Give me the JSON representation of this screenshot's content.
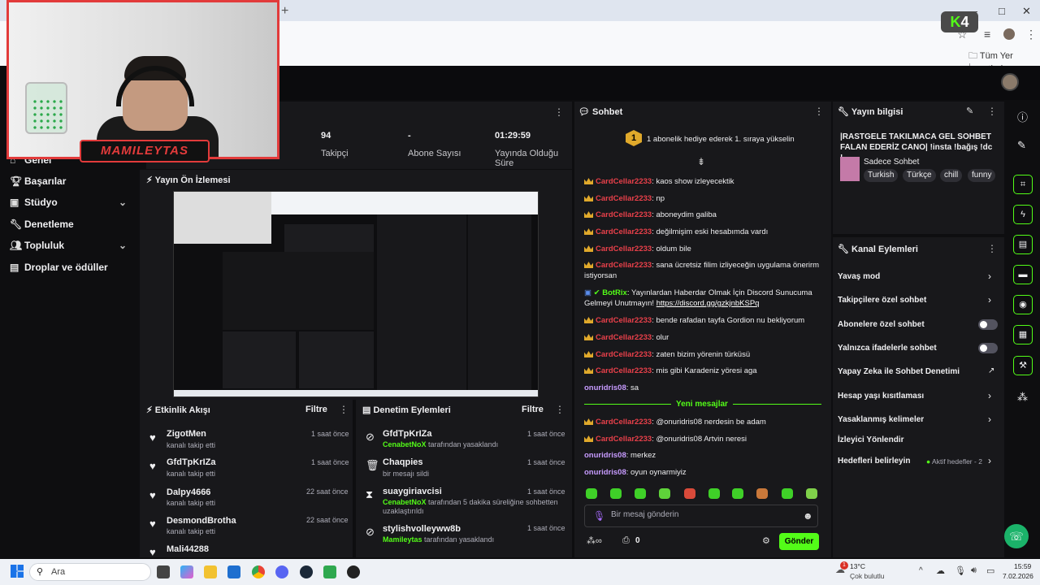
{
  "browser": {
    "new_tab": "+",
    "window_controls": [
      "—",
      "□",
      "✕"
    ],
    "extension_badge": "4",
    "bookmarks_label": "Tüm Yer İşaretleri"
  },
  "nav": {
    "items": [
      {
        "label": "Genel"
      },
      {
        "label": "Başarılar"
      },
      {
        "label": "Stüdyo"
      },
      {
        "label": "Denetleme"
      },
      {
        "label": "Topluluk"
      },
      {
        "label": "Droplar ve ödüller"
      }
    ]
  },
  "webcam": {
    "logo_text": "MAMILEYTAS"
  },
  "stats": {
    "items": [
      {
        "value": "94",
        "label": "Takipçi"
      },
      {
        "value": "-",
        "label": "Abone Sayısı"
      },
      {
        "value": "01:29:59",
        "label": "Yayında Olduğu Süre"
      }
    ]
  },
  "preview": {
    "title": "Yayın Ön İzlemesi"
  },
  "activity": {
    "title": "Etkinlik Akışı",
    "filter": "Filtre",
    "items": [
      {
        "name": "ZigotMen",
        "desc": "kanalı takip etti",
        "time": "1 saat önce"
      },
      {
        "name": "GfdTpKrIZa",
        "desc": "kanalı takip etti",
        "time": "1 saat önce"
      },
      {
        "name": "Dalpy4666",
        "desc": "kanalı takip etti",
        "time": "22 saat önce"
      },
      {
        "name": "DesmondBrotha",
        "desc": "kanalı takip etti",
        "time": "22 saat önce"
      },
      {
        "name": "Mali44288",
        "desc": "",
        "time": ""
      }
    ]
  },
  "moderation": {
    "title": "Denetim Eylemleri",
    "filter": "Filtre",
    "items": [
      {
        "name": "GfdTpKrIZa",
        "actor": "CenabetNoX",
        "desc": " tarafından yasaklandı",
        "time": "1 saat önce"
      },
      {
        "name": "Chaqpies",
        "actor": "",
        "desc": "bir mesajı sildi",
        "time": "1 saat önce"
      },
      {
        "name": "suaygiriavcisi",
        "actor": "CenabetNoX",
        "desc": " tarafından 5 dakika süreliğine sohbetten uzaklaştırıldı",
        "time": "1 saat önce"
      },
      {
        "name": "stylishvolleyww8b",
        "actor": "Mamileytas",
        "desc": " tarafından yasaklandı",
        "time": "1 saat önce"
      }
    ]
  },
  "chat": {
    "title": "Sohbet",
    "promo": "1 abonelik hediye ederek 1. sıraya yükselin",
    "new_messages": "Yeni mesajlar",
    "input_placeholder": "Bir mesaj gönderin",
    "points": "0",
    "send": "Gönder",
    "messages": [
      {
        "user": "CardCellar2233",
        "text": ": kaos show izleyecektik"
      },
      {
        "user": "CardCellar2233",
        "text": ": np"
      },
      {
        "user": "CardCellar2233",
        "text": ": aboneydim galiba"
      },
      {
        "user": "CardCellar2233",
        "text": ": değilmişim eski hesabımda vardı"
      },
      {
        "user": "CardCellar2233",
        "text": ": oldum bile"
      },
      {
        "user": "CardCellar2233",
        "text": ": sana ücretsiz filim izliyeceğin uygulama önerirm istiyorsan"
      },
      {
        "user": "BotRix",
        "text": ": Yayınlardan Haberdar Olmak İçin Discord Sunucuma Gelmeyi Unutmayın! ",
        "link": "https://discord.gg/gzkjnbKSPq"
      },
      {
        "user": "CardCellar2233",
        "text": ": bende rafadan tayfa Gordion nu bekliyorum"
      },
      {
        "user": "CardCellar2233",
        "text": ": olur"
      },
      {
        "user": "CardCellar2233",
        "text": ": zaten bizim yörenin türküsü"
      },
      {
        "user": "CardCellar2233",
        "text": ": mis gibi Karadeniz yöresi aga"
      },
      {
        "user": "onuridris08",
        "text": ": sa"
      },
      {
        "user": "CardCellar2233",
        "text": ": @onuridris08 nerdesin be adam"
      },
      {
        "user": "CardCellar2233",
        "text": ": @onuridris08 Artvin neresi"
      },
      {
        "user": "onuridris08",
        "text": ": merkez"
      },
      {
        "user": "onuridris08",
        "text": ": oyun oynarmiyiz"
      }
    ]
  },
  "stream_info": {
    "title": "Yayın bilgisi",
    "stream_title": "|RASTGELE TAKILMACA GEL SOHBET FALAN EDERİZ CANO| !insta !bağış !dc !...",
    "category": "Sadece Sohbet",
    "tags": [
      "Turkish",
      "Türkçe",
      "chill",
      "funny"
    ]
  },
  "channel_actions": {
    "title": "Kanal Eylemleri",
    "items": [
      {
        "label": "Yavaş mod",
        "type": "arrow"
      },
      {
        "label": "Takipçilere özel sohbet",
        "type": "arrow"
      },
      {
        "label": "Abonelere özel sohbet",
        "type": "toggle"
      },
      {
        "label": "Yalnızca ifadelerle sohbet",
        "type": "toggle"
      },
      {
        "label": "Yapay Zeka ile Sohbet Denetimi",
        "type": "external"
      },
      {
        "label": "Hesap yaşı kısıtlaması",
        "type": "arrow"
      },
      {
        "label": "Yasaklanmış kelimeler",
        "type": "arrow"
      },
      {
        "label": "İzleyici Yönlendir",
        "type": "none"
      },
      {
        "label": "Hedefleri belirleyin",
        "type": "arrow"
      }
    ],
    "goals_status": "Aktif hedefler - 2"
  },
  "taskbar": {
    "search_placeholder": "Ara",
    "weather_temp": "13°C",
    "weather_desc": "Çok bulutlu",
    "time": "15:59",
    "date": "7.02.2026",
    "notification_count": "1"
  },
  "colors": {
    "accent": "#53fc18",
    "panel": "#18181b",
    "background": "#0e0e10",
    "chat_user": "#e9404a",
    "chat_user_alt": "#c79bff"
  }
}
